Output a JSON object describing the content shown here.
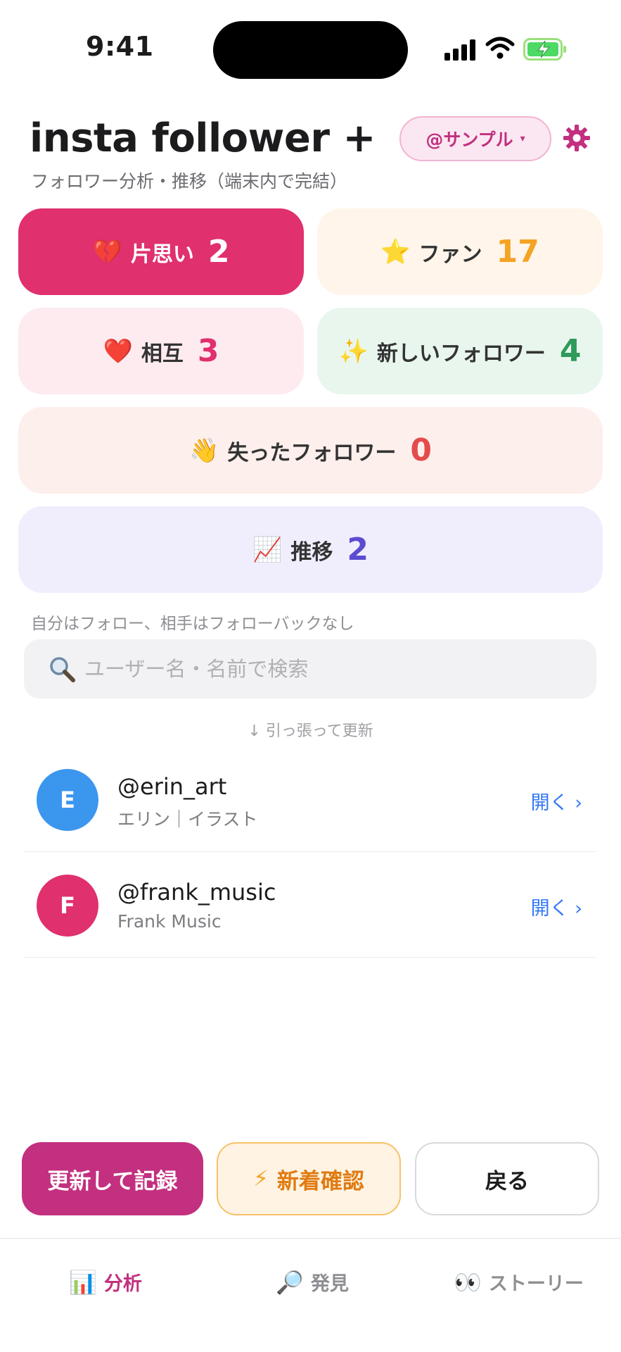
{
  "status_bar": {
    "time": "9:41"
  },
  "header": {
    "title": "insta follower +",
    "subtitle": "フォロワー分析・推移（端末内で完結）",
    "account": "@サンプル",
    "account_caret": "▾"
  },
  "cards": {
    "unrequited": {
      "emoji": "💔",
      "label": "片思い",
      "count": "2"
    },
    "fans": {
      "emoji": "⭐",
      "label": "ファン",
      "count": "17"
    },
    "mutual": {
      "emoji": "❤️",
      "label": "相互",
      "count": "3"
    },
    "new_followers": {
      "emoji": "✨",
      "label": "新しいフォロワー",
      "count": "4"
    },
    "lost_followers": {
      "emoji": "👋",
      "label": "失ったフォロワー",
      "count": "0"
    },
    "trend": {
      "emoji": "📈",
      "label": "推移",
      "count": "2"
    }
  },
  "section_hint": "自分はフォロー、相手はフォローバックなし",
  "search": {
    "placeholder": "ユーザー名・名前で検索"
  },
  "pull_hint": "↓ 引っ張って更新",
  "users": [
    {
      "initial": "E",
      "username": "@erin_art",
      "display_name": "エリン｜イラスト",
      "open_label": "開く ›",
      "avatar_color": "#3b96ee"
    },
    {
      "initial": "F",
      "username": "@frank_music",
      "display_name": "Frank Music",
      "open_label": "開く ›",
      "avatar_color": "#e0306e"
    }
  ],
  "actions": {
    "refresh_label": "更新して記録",
    "check_icon": "⚡",
    "check_label": "新着確認",
    "back_label": "戻る"
  },
  "tabs": [
    {
      "icon": "📊",
      "label": "分析"
    },
    {
      "icon": "🔎",
      "label": "発見"
    },
    {
      "icon": "👀",
      "label": "ストーリー"
    }
  ],
  "colors": {
    "accent": "#c2307f",
    "unrequited": "#e0306e",
    "fans": "#f4a324",
    "new": "#2f9a5a",
    "lost": "#e54b4b",
    "trend": "#5b4ccf",
    "link": "#3478f6"
  }
}
